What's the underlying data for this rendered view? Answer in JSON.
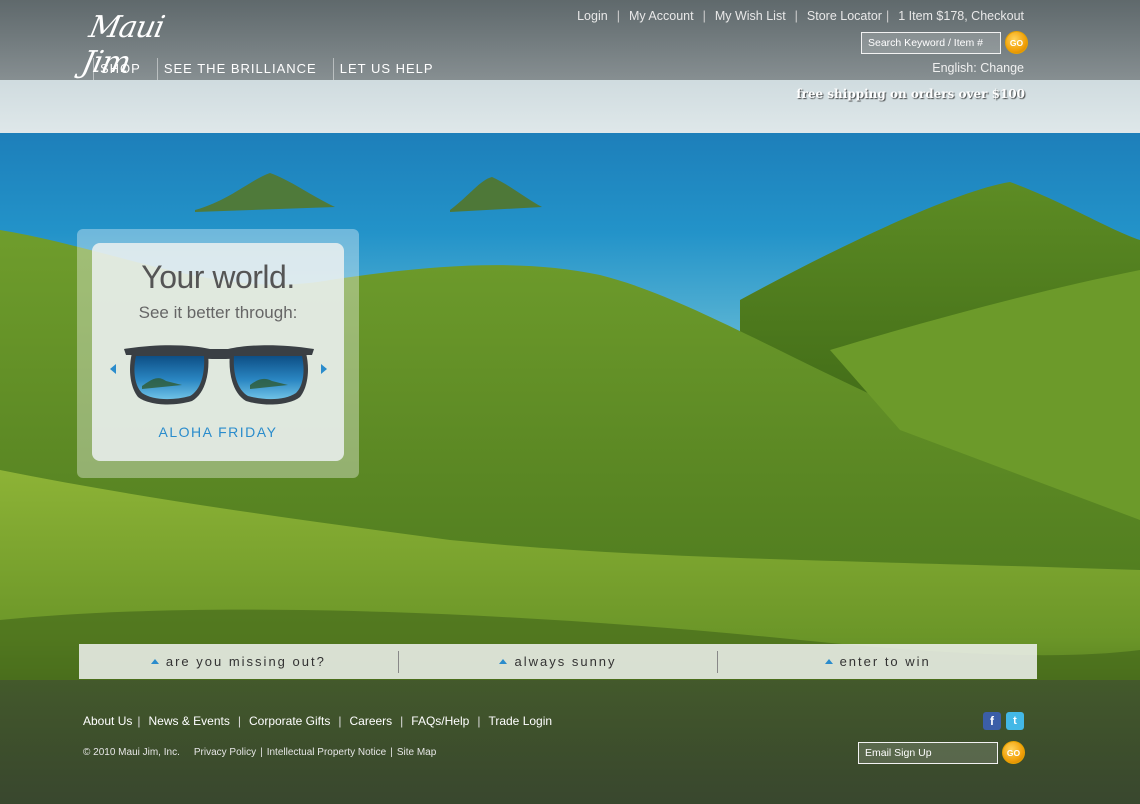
{
  "header": {
    "logo_text": "Maui Jim",
    "util_nav": {
      "login": "Login",
      "my_account": "My Account",
      "wish_list": "My Wish List",
      "store_locator": "Store Locator",
      "cart": "1 Item $178, Checkout"
    },
    "search": {
      "placeholder": "Search Keyword / Item #",
      "go_label": "GO"
    },
    "main_nav": [
      "SHOP",
      "SEE THE BRILLIANCE",
      "LET US HELP"
    ],
    "language": "English: Change",
    "shipping_banner": "free shipping on orders over $100"
  },
  "promo": {
    "headline": "Your world.",
    "subheadline": "See it better through:",
    "product_name": "ALOHA FRIDAY"
  },
  "tabs": [
    "are you missing out?",
    "always sunny",
    "enter to win"
  ],
  "footer": {
    "nav": [
      "About Us",
      "News & Events",
      "Corporate Gifts",
      "Careers",
      "FAQs/Help",
      "Trade Login"
    ],
    "copyright": "© 2010 Maui Jim, Inc.",
    "legal_links": [
      "Privacy Policy",
      "Intellectual Property Notice",
      "Site Map"
    ],
    "social": {
      "facebook_glyph": "f",
      "twitter_glyph": "t"
    },
    "email_signup": {
      "placeholder": "Email Sign Up",
      "go_label": "GO"
    }
  },
  "colors": {
    "accent_blue": "#2a8ccc",
    "go_button_orange": "#f2a10a",
    "facebook_blue": "#3b5ea8",
    "twitter_blue": "#43b8e6"
  },
  "icons": [
    "go-button",
    "prev-arrow-icon",
    "next-arrow-icon",
    "tab-arrow-icon",
    "facebook-icon",
    "twitter-icon",
    "sunglasses-image"
  ]
}
